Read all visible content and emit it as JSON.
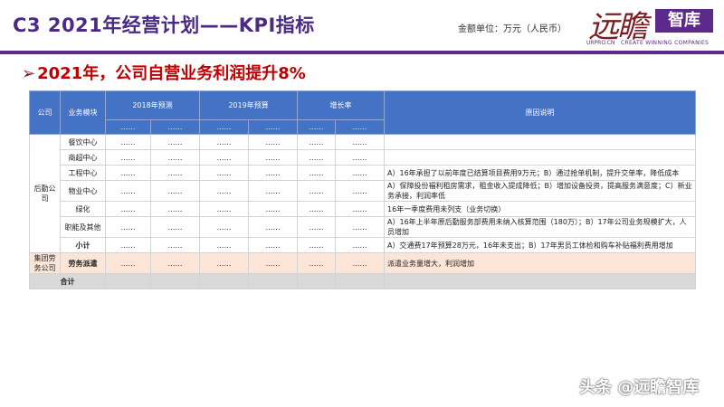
{
  "header": {
    "title": "C3  2021年经营计划——KPI指标",
    "unit_note": "金额单位：万元（人民币）",
    "logo": {
      "calligraphy": "远瞻",
      "badge": "智库",
      "url": "URPRO.CN",
      "slogan": "CREATE WINNING COMPANIES"
    },
    "accent_color": "#5b2a8a"
  },
  "subtitle": {
    "arrow": "➢",
    "text": "2021年，公司自营业务利润提升8%"
  },
  "table": {
    "headers": {
      "company": "公司",
      "module": "业务模块",
      "forecast_2018": "2018年预测",
      "budget_2019": "2019年预算",
      "growth": "增长率",
      "reason": "原因说明",
      "placeholder": "……"
    },
    "group_logistics": "后勤公司",
    "group_dispatch": "集团劳务公司",
    "rows": [
      {
        "module": "餐饮中心",
        "v": [
          "……",
          "……",
          "……",
          "……",
          "……",
          "……"
        ],
        "reason": ""
      },
      {
        "module": "商超中心",
        "v": [
          "……",
          "……",
          "……",
          "……",
          "……",
          "……"
        ],
        "reason": ""
      },
      {
        "module": "工程中心",
        "v": [
          "……",
          "……",
          "……",
          "……",
          "……",
          "……"
        ],
        "reason": "A）16年承担了以前年度已结算项目费用9万元；B）通过抢单机制，提升交单率，降低成本"
      },
      {
        "module": "物业中心",
        "v": [
          "……",
          "……",
          "……",
          "……",
          "……",
          "……"
        ],
        "reason": "A）保障投份福利租房需求，租金收入提成降低；B）增加设备投资，提高服务满意度；C）新业务承接，利润率低"
      },
      {
        "module": "绿化",
        "v": [
          "……",
          "……",
          "……",
          "……",
          "……",
          "……"
        ],
        "reason": "16年一季度费用未列支（业务切换）"
      },
      {
        "module": "职能及其他",
        "v": [
          "……",
          "……",
          "……",
          "……",
          "……",
          "……"
        ],
        "reason": "A）16年上半年原后勤服务部费用未纳入核算范围（180万）；B）17年公司业务规模扩大，人员增加"
      },
      {
        "module": "小计",
        "v": [
          "……",
          "……",
          "……",
          "……",
          "……",
          "……"
        ],
        "reason": "A）交通费17年预算28万元，16年未支出；B）17年男员工体检和购车补贴福利费用增加"
      }
    ],
    "dispatch_row": {
      "module": "劳务派遣",
      "v": [
        "……",
        "……",
        "……",
        "……",
        "……",
        "……"
      ],
      "reason": "派遣业务量增大，利润增加"
    },
    "total_row": {
      "label": "合计"
    }
  },
  "watermark": "头条 @远瞻智库"
}
